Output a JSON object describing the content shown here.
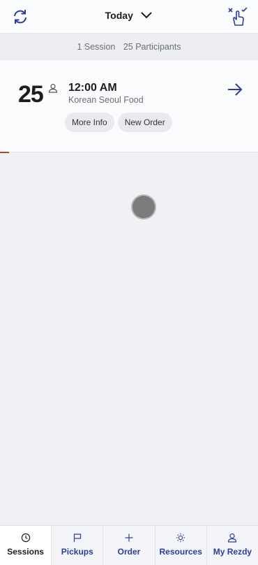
{
  "header": {
    "date_label": "Today",
    "refresh_icon": "refresh-icon",
    "select_icon": "multi-select-hand-icon"
  },
  "summary": {
    "sessions": "1 Session",
    "participants": "25 Participants"
  },
  "session": {
    "count": "25",
    "time": "12:00 AM",
    "name": "Korean Seoul Food",
    "more_info_label": "More Info",
    "new_order_label": "New Order"
  },
  "bottom_nav": {
    "sessions": "Sessions",
    "pickups": "Pickups",
    "order": "Order",
    "resources": "Resources",
    "my_rezdy": "My Rezdy"
  },
  "colors": {
    "accent": "#2c3e9a",
    "background": "#eff1f5",
    "progress": "#c0402a"
  }
}
